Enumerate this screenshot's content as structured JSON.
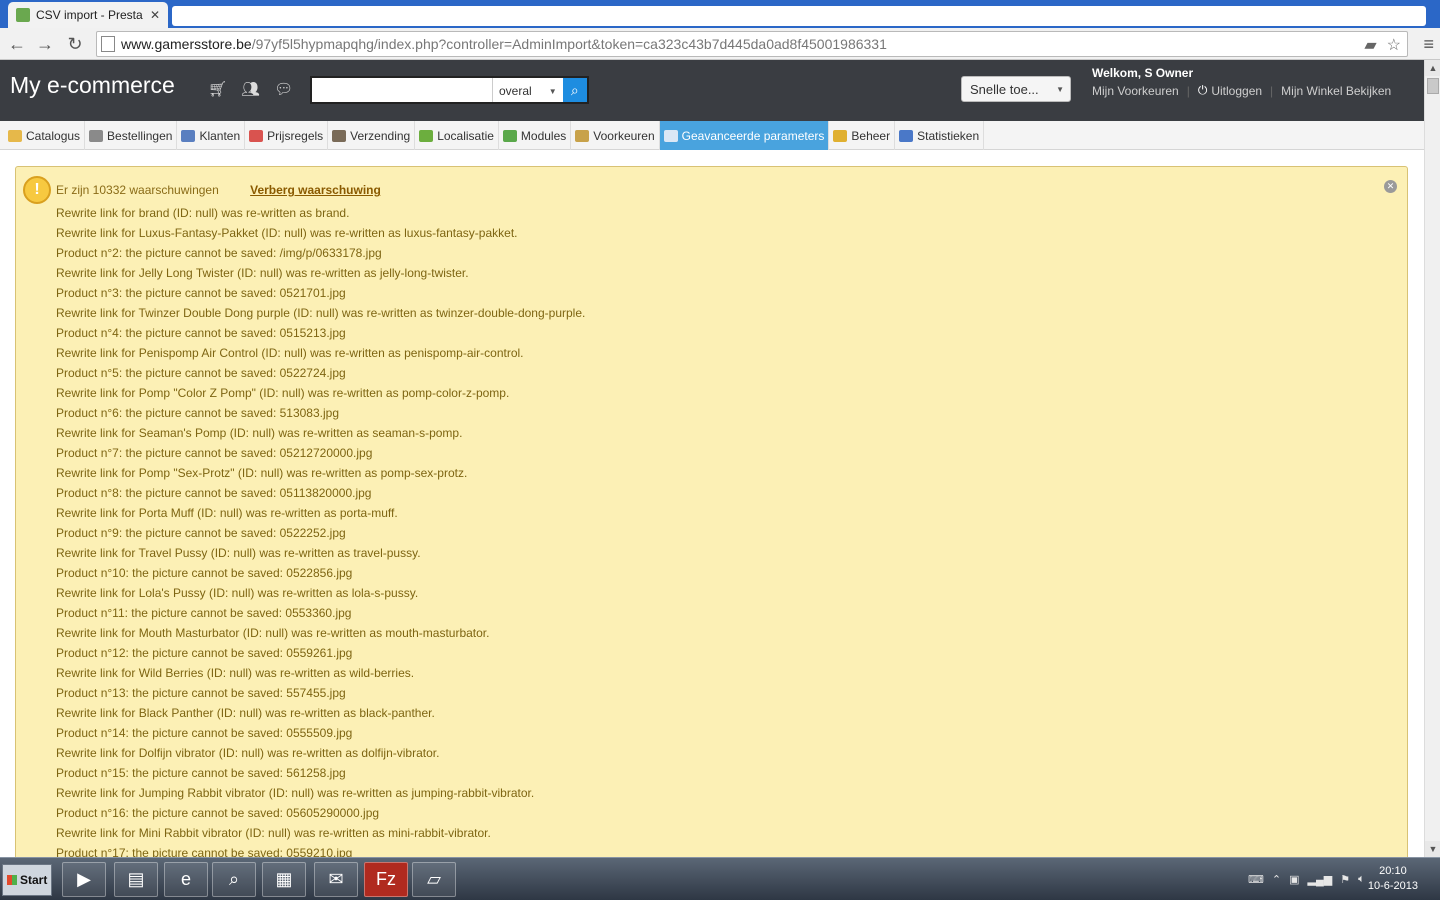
{
  "browser": {
    "tab_title": "CSV import - Presta",
    "url_host": "www.gamersstore.be",
    "url_path": "/97yf5l5hypmapqhg/index.php?controller=AdminImport&token=ca323c43b7d445da0ad8f45001986331"
  },
  "header": {
    "brand": "My e-commerce",
    "search_scope": "overal",
    "quick_access": "Snelle toe...",
    "welcome": "Welkom, S Owner",
    "links": {
      "prefs": "Mijn Voorkeuren",
      "logout": "Uitloggen",
      "view_shop": "Mijn Winkel Bekijken"
    }
  },
  "menu": [
    {
      "label": "Catalogus",
      "color": "#e6b84a"
    },
    {
      "label": "Bestellingen",
      "color": "#8a8a8a"
    },
    {
      "label": "Klanten",
      "color": "#5a7fc0"
    },
    {
      "label": "Prijsregels",
      "color": "#d9534f"
    },
    {
      "label": "Verzending",
      "color": "#7a6b58"
    },
    {
      "label": "Localisatie",
      "color": "#6cae3e"
    },
    {
      "label": "Modules",
      "color": "#5aa84a"
    },
    {
      "label": "Voorkeuren",
      "color": "#c8a24a"
    },
    {
      "label": "Geavanceerde parameters",
      "color": "#dbe7f5"
    },
    {
      "label": "Beheer",
      "color": "#e0b030"
    },
    {
      "label": "Statistieken",
      "color": "#4a78c8"
    }
  ],
  "warning": {
    "count_text": "Er zijn 10332 waarschuwingen",
    "toggle_label": "Verberg waarschuwing",
    "items": [
      "Rewrite link for brand (ID: null) was re-written as brand.",
      "Rewrite link for Luxus-Fantasy-Pakket (ID: null) was re-written as luxus-fantasy-pakket.",
      "Product n°2: the picture cannot be saved: /img/p/0633178.jpg",
      "Rewrite link for Jelly Long Twister (ID: null) was re-written as jelly-long-twister.",
      "Product n°3: the picture cannot be saved: 0521701.jpg",
      "Rewrite link for Twinzer Double Dong purple (ID: null) was re-written as twinzer-double-dong-purple.",
      "Product n°4: the picture cannot be saved: 0515213.jpg",
      "Rewrite link for Penispomp Air Control (ID: null) was re-written as penispomp-air-control.",
      "Product n°5: the picture cannot be saved: 0522724.jpg",
      "Rewrite link for Pomp \"Color Z Pomp\" (ID: null) was re-written as pomp-color-z-pomp.",
      "Product n°6: the picture cannot be saved: 513083.jpg",
      "Rewrite link for Seaman's Pomp (ID: null) was re-written as seaman-s-pomp.",
      "Product n°7: the picture cannot be saved: 05212720000.jpg",
      "Rewrite link for Pomp \"Sex-Protz\" (ID: null) was re-written as pomp-sex-protz.",
      "Product n°8: the picture cannot be saved: 05113820000.jpg",
      "Rewrite link for Porta Muff (ID: null) was re-written as porta-muff.",
      "Product n°9: the picture cannot be saved: 0522252.jpg",
      "Rewrite link for Travel Pussy (ID: null) was re-written as travel-pussy.",
      "Product n°10: the picture cannot be saved: 0522856.jpg",
      "Rewrite link for Lola's Pussy (ID: null) was re-written as lola-s-pussy.",
      "Product n°11: the picture cannot be saved: 0553360.jpg",
      "Rewrite link for Mouth Masturbator (ID: null) was re-written as mouth-masturbator.",
      "Product n°12: the picture cannot be saved: 0559261.jpg",
      "Rewrite link for Wild Berries (ID: null) was re-written as wild-berries.",
      "Product n°13: the picture cannot be saved: 557455.jpg",
      "Rewrite link for Black Panther (ID: null) was re-written as black-panther.",
      "Product n°14: the picture cannot be saved: 0555509.jpg",
      "Rewrite link for Dolfijn vibrator (ID: null) was re-written as dolfijn-vibrator.",
      "Product n°15: the picture cannot be saved: 561258.jpg",
      "Rewrite link for Jumping Rabbit vibrator (ID: null) was re-written as jumping-rabbit-vibrator.",
      "Product n°16: the picture cannot be saved: 05605290000.jpg",
      "Rewrite link for Mini Rabbit vibrator (ID: null) was re-written as mini-rabbit-vibrator.",
      "Product n°17: the picture cannot be saved: 0559210.jpg"
    ]
  },
  "taskbar": {
    "start_label": "Start",
    "time": "20:10",
    "date": "10-6-2013"
  }
}
